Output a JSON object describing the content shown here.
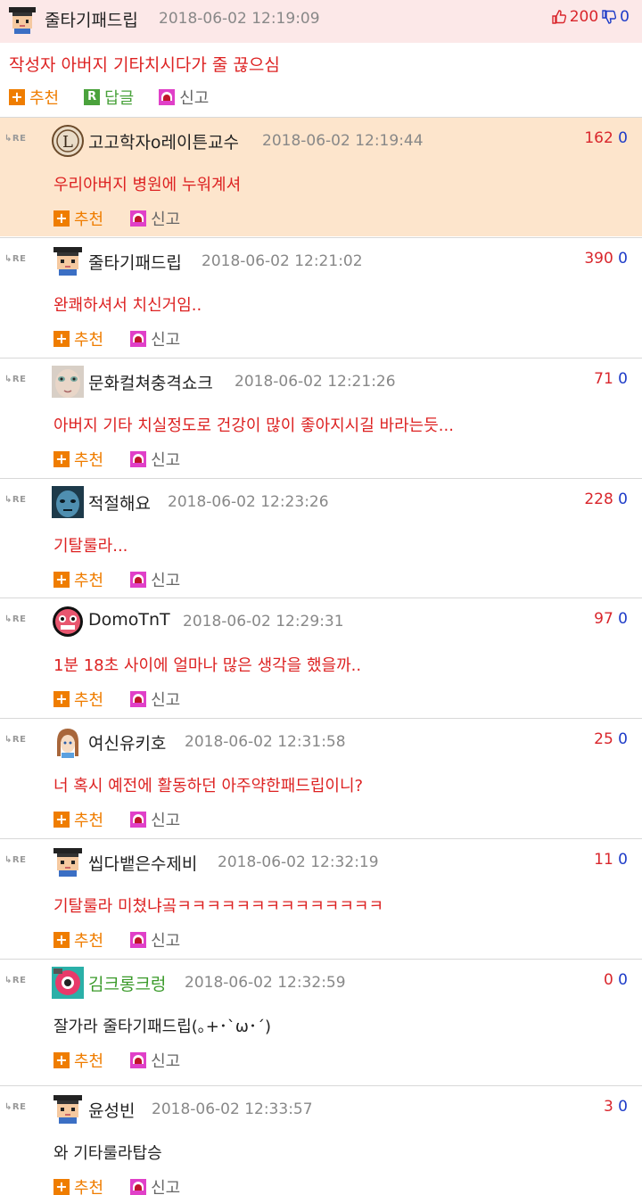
{
  "post": {
    "author": "줄타기패드립",
    "date": "2018-06-02 12:19:09",
    "up_votes": "200",
    "down_votes": "0",
    "title": "작성자 아버지 기타치시다가 줄 끊으심",
    "actions": {
      "recommend": "추천",
      "reply": "답글",
      "report": "신고"
    }
  },
  "labels": {
    "re": "RE",
    "recommend": "추천",
    "report": "신고"
  },
  "comments": [
    {
      "author": "고고학자o레이튼교수",
      "date": "2018-06-02 12:19:44",
      "up": "162",
      "down": "0",
      "text": "우리아버지 병원에 누워계셔",
      "avatar": "layton-avatar",
      "highlight": true,
      "red": true
    },
    {
      "author": "줄타기패드립",
      "date": "2018-06-02 12:21:02",
      "up": "390",
      "down": "0",
      "text": "완쾌하셔서 치신거임..",
      "avatar": "pixel-boy-avatar",
      "highlight": false,
      "red": true
    },
    {
      "author": "문화컬쳐충격쇼크",
      "date": "2018-06-02 12:21:26",
      "up": "71",
      "down": "0",
      "text": "아버지 기타 치실정도로 건강이 많이 좋아지시길 바라는듯...",
      "avatar": "face-avatar",
      "highlight": false,
      "red": true
    },
    {
      "author": "적절해요",
      "date": "2018-06-02 12:23:26",
      "up": "228",
      "down": "0",
      "text": "기탈룰라...",
      "avatar": "blue-face-avatar",
      "highlight": false,
      "red": true
    },
    {
      "author": "DomoTnT",
      "date": "2018-06-02 12:29:31",
      "up": "97",
      "down": "0",
      "text": "1분 18초 사이에 얼마나 많은 생각을 했을까..",
      "avatar": "pink-blob-avatar",
      "highlight": false,
      "red": true
    },
    {
      "author": "여신유키호",
      "date": "2018-06-02 12:31:58",
      "up": "25",
      "down": "0",
      "text": "너 혹시 예전에 활동하던 아주약한패드립이니?",
      "avatar": "anime-girl-avatar",
      "highlight": false,
      "red": true
    },
    {
      "author": "씹다뱉은수제비",
      "date": "2018-06-02 12:32:19",
      "up": "11",
      "down": "0",
      "text": "기탈룰라 미쳤냐곸ㅋㅋㅋㅋㅋㅋㅋㅋㅋㅋㅋㅋㅋㅋ",
      "avatar": "pixel-boy-avatar",
      "highlight": false,
      "red": true
    },
    {
      "author": "김크롱크렁",
      "date": "2018-06-02 12:32:59",
      "up": "0",
      "down": "0",
      "text": "잘가라 줄타기패드립(｡+･`ω･´)",
      "avatar": "pink-eye-avatar",
      "highlight": false,
      "red": false,
      "name_color": "#3a9a2a"
    },
    {
      "author": "윤성빈",
      "date": "2018-06-02 12:33:57",
      "up": "3",
      "down": "0",
      "text": "와 기타룰라탑승",
      "avatar": "pixel-boy-avatar",
      "highlight": false,
      "red": false
    }
  ]
}
